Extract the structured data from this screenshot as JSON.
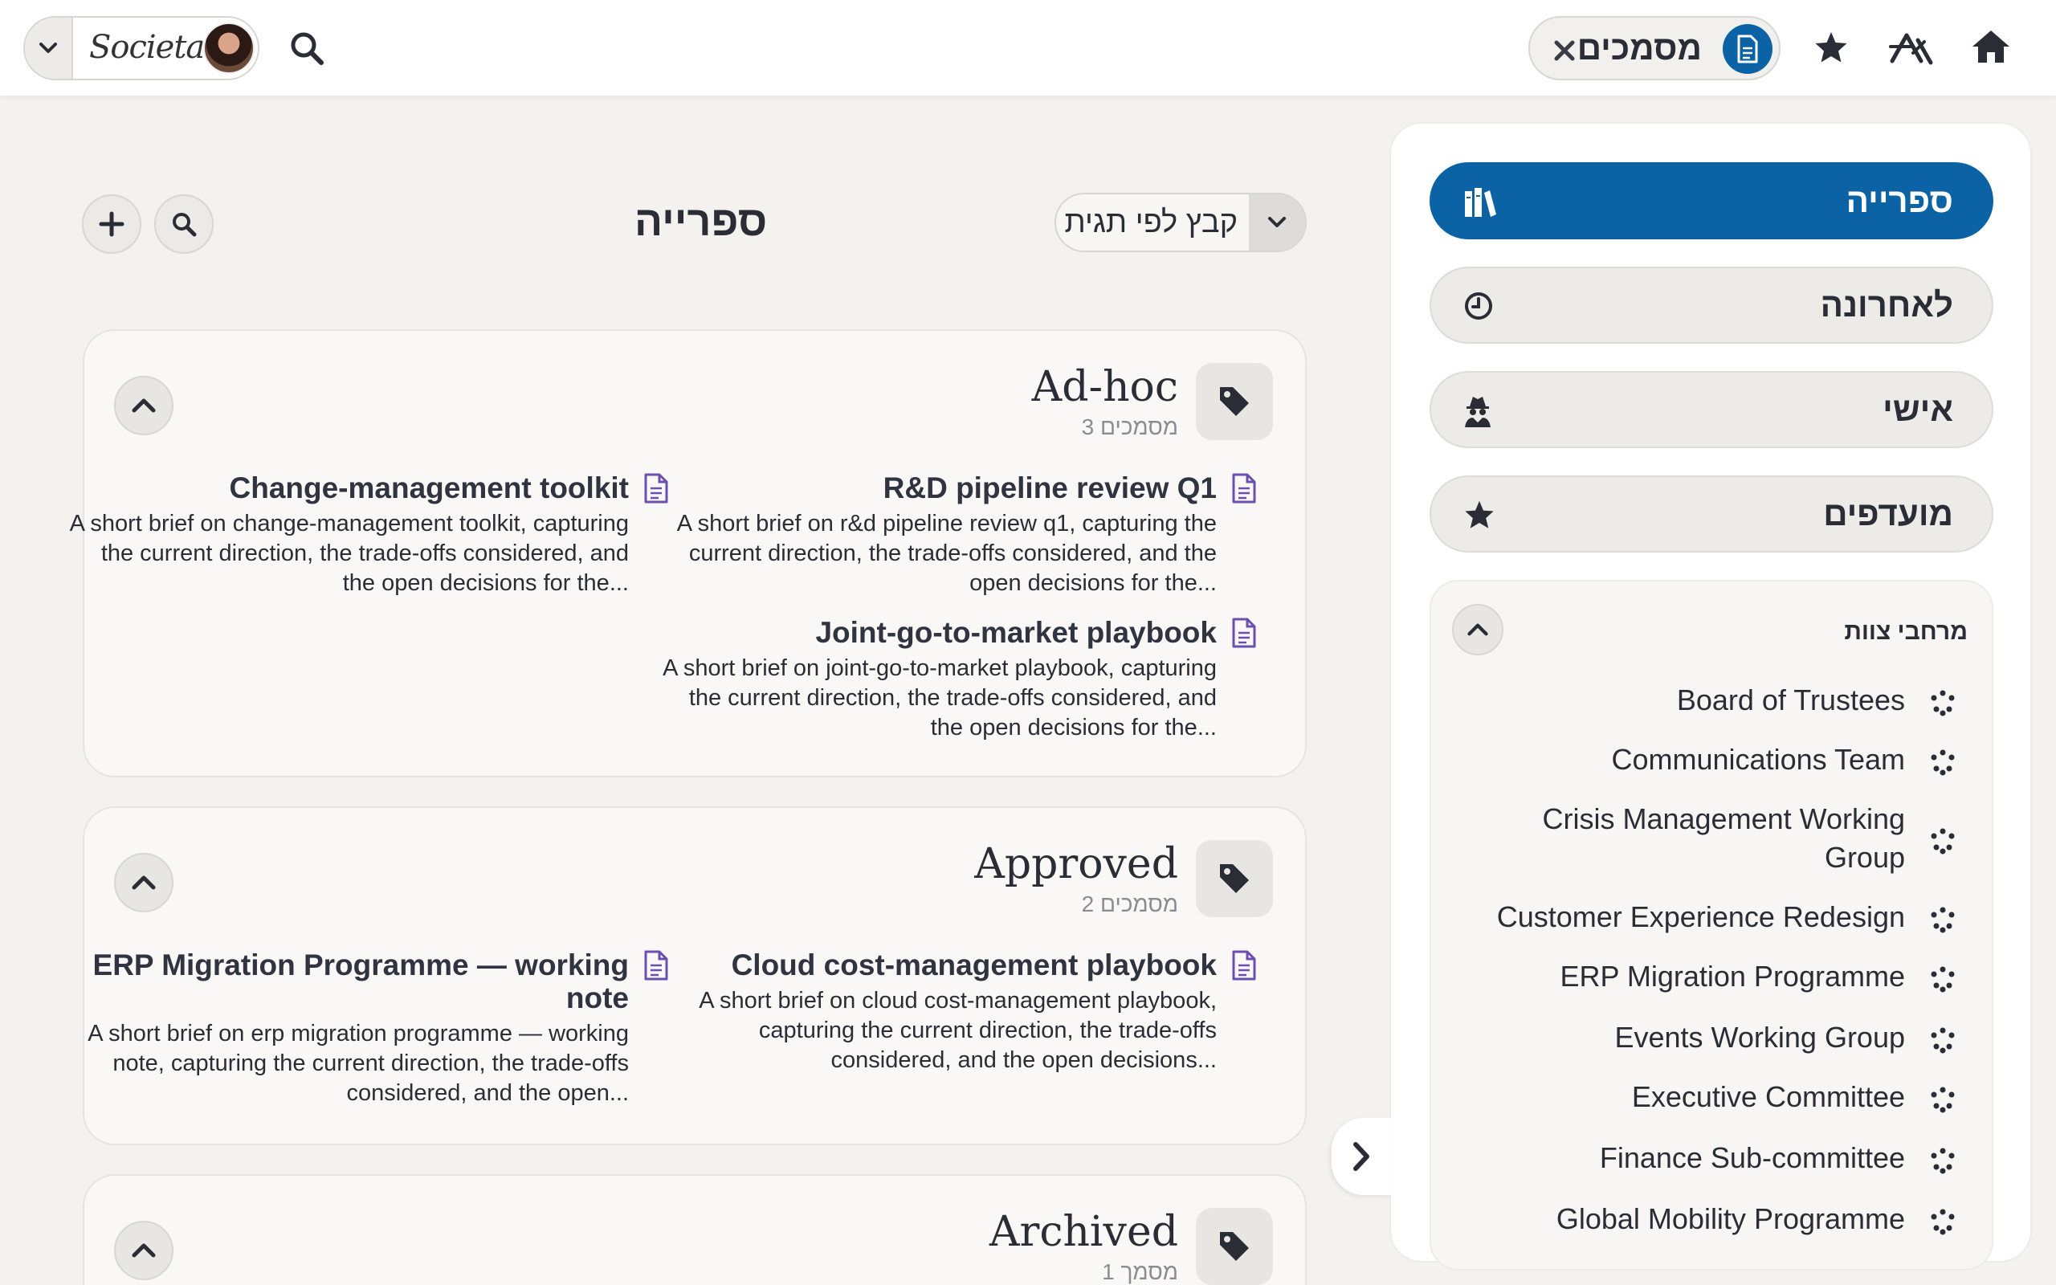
{
  "topbar": {
    "logo_text": "Societas",
    "active_tab": {
      "label": "מסמכים",
      "icon": "document-icon"
    },
    "icons": [
      "chevron-down-icon",
      "search-icon",
      "close-icon",
      "star-icon",
      "apps-icon",
      "home-icon"
    ]
  },
  "main": {
    "title": "ספרייה",
    "group_select": {
      "label": "קבץ לפי תגית"
    },
    "tags": [
      {
        "name": "Ad-hoc",
        "count": "3 מסמכים",
        "docs": [
          {
            "title": "R&D pipeline review Q1",
            "desc": "A short brief on r&d pipeline review q1, capturing the current direction, the trade-offs considered, and the open decisions for the..."
          },
          {
            "title": "Change-management toolkit",
            "desc": "A short brief on change-management toolkit, capturing the current direction, the trade-offs considered, and the open decisions for the..."
          },
          {
            "title": "Joint-go-to-market playbook",
            "desc": "A short brief on joint-go-to-market playbook, capturing the current direction, the trade-offs considered, and the open decisions for the..."
          }
        ]
      },
      {
        "name": "Approved",
        "count": "2 מסמכים",
        "docs": [
          {
            "title": "Cloud cost-management playbook",
            "desc": "A short brief on cloud cost-management playbook, capturing the current direction, the trade-offs considered, and the open decisions..."
          },
          {
            "title": "ERP Migration Programme — working note",
            "desc": "A short brief on erp migration programme — working note, capturing the current direction, the trade-offs considered, and the open..."
          }
        ]
      },
      {
        "name": "Archived",
        "count": "1 מסמך",
        "docs": []
      }
    ]
  },
  "sidebar": {
    "nav": [
      {
        "label": "ספרייה",
        "icon": "library-icon",
        "active": true
      },
      {
        "label": "לאחרונה",
        "icon": "clock-icon",
        "active": false
      },
      {
        "label": "אישי",
        "icon": "user-secret-icon",
        "active": false
      },
      {
        "label": "מועדפים",
        "icon": "star-icon",
        "active": false
      }
    ],
    "teams_title": "מרחבי צוות",
    "teams": [
      "Board of Trustees",
      "Communications Team",
      "Crisis Management Working Group",
      "Customer Experience Redesign",
      "ERP Migration Programme",
      "Events Working Group",
      "Executive Committee",
      "Finance Sub-committee",
      "Global Mobility Programme"
    ]
  },
  "colors": {
    "accent": "#0b63a5",
    "doc_icon": "#6b4fb0",
    "background": "#f4f2ef"
  }
}
